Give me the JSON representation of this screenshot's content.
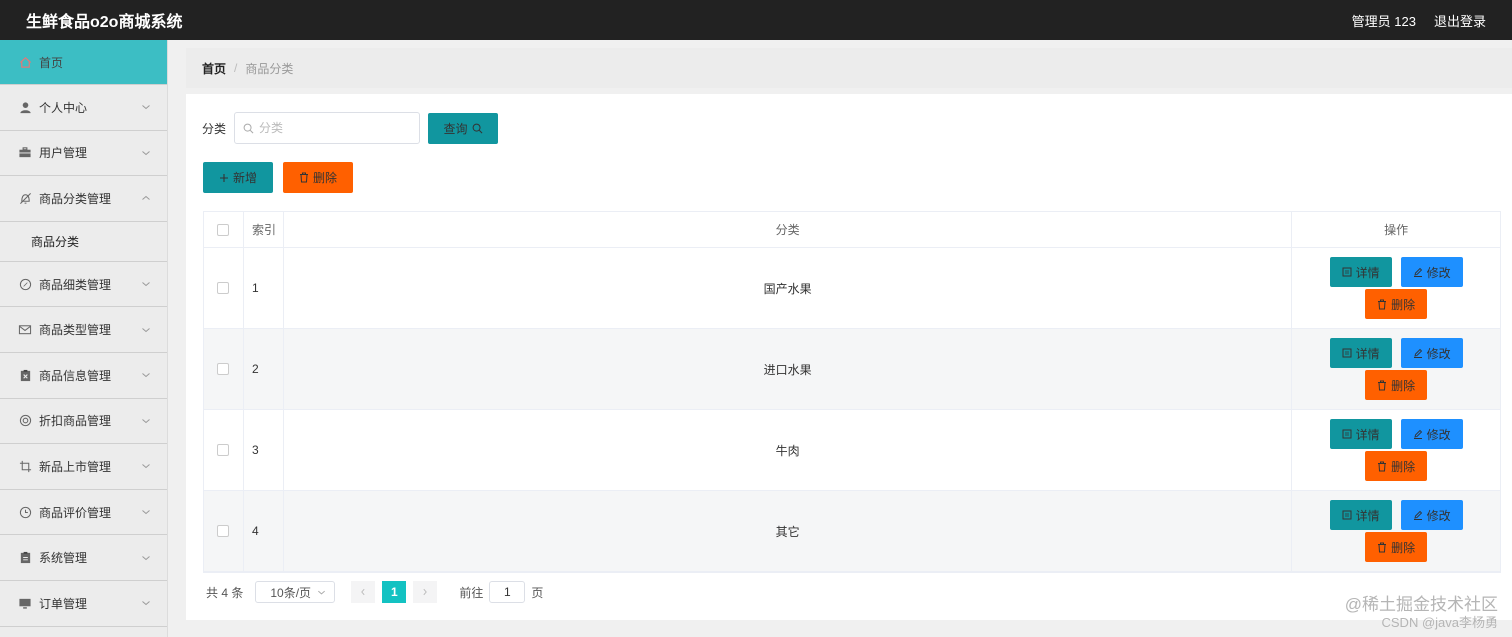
{
  "app": {
    "title": "生鲜食品o2o商城系统"
  },
  "user": {
    "label": "管理员 123",
    "logout": "退出登录"
  },
  "sidebar": {
    "items": [
      {
        "label": "首页",
        "icon": "home-icon"
      },
      {
        "label": "个人中心",
        "icon": "user-icon"
      },
      {
        "label": "用户管理",
        "icon": "briefcase-icon"
      },
      {
        "label": "商品分类管理",
        "icon": "bell-off-icon"
      },
      {
        "label": "商品分类"
      },
      {
        "label": "商品细类管理",
        "icon": "compass-icon"
      },
      {
        "label": "商品类型管理",
        "icon": "mail-icon"
      },
      {
        "label": "商品信息管理",
        "icon": "clipboard-x-icon"
      },
      {
        "label": "折扣商品管理",
        "icon": "lifebuoy-icon"
      },
      {
        "label": "新品上市管理",
        "icon": "crop-icon"
      },
      {
        "label": "商品评价管理",
        "icon": "clock-icon"
      },
      {
        "label": "系统管理",
        "icon": "clipboard-icon"
      },
      {
        "label": "订单管理",
        "icon": "monitor-icon"
      }
    ]
  },
  "breadcrumb": {
    "home": "首页",
    "separator": "/",
    "current": "商品分类"
  },
  "search": {
    "label": "分类",
    "placeholder": "分类",
    "value": "",
    "button": "查询"
  },
  "actions": {
    "add": "新增",
    "delete": "删除"
  },
  "table": {
    "headers": {
      "index": "索引",
      "category": "分类",
      "operations": "操作"
    },
    "rows": [
      {
        "index": "1",
        "category": "国产水果"
      },
      {
        "index": "2",
        "category": "进口水果"
      },
      {
        "index": "3",
        "category": "牛肉"
      },
      {
        "index": "4",
        "category": "其它"
      }
    ],
    "row_buttons": {
      "detail": "详情",
      "edit": "修改",
      "delete": "删除"
    }
  },
  "pagination": {
    "total": "共 4 条",
    "page_size": "10条/页",
    "current_page": "1",
    "goto_label": "前往",
    "goto_value": "1",
    "page_suffix": "页"
  },
  "watermark": {
    "line1": "@稀土掘金技术社区",
    "line2": "CSDN @java李杨勇"
  },
  "colors": {
    "topbar": "#222222",
    "sidebar_active": "#3cbec4",
    "teal_button": "#11969f",
    "orange_button": "#ff6000",
    "blue_button": "#1e90ff",
    "page_active": "#13c2c2"
  }
}
